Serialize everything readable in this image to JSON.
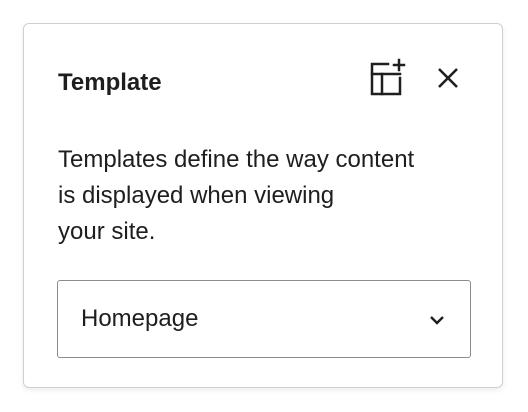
{
  "panel": {
    "title": "Template",
    "header_icons": {
      "add_template": "add-template-icon",
      "close": "close-icon"
    },
    "description_lines": [
      "Templates define the way content",
      "is displayed when viewing",
      "your site."
    ],
    "select": {
      "value": "Homepage",
      "icon": "chevron-down-icon"
    }
  }
}
